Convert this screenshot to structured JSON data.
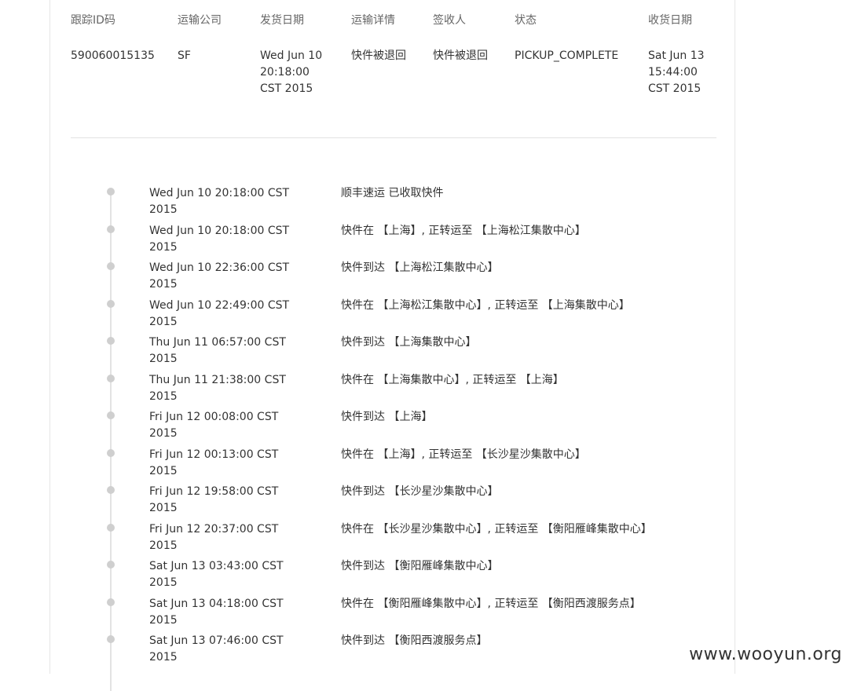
{
  "table": {
    "headers": [
      "跟踪ID码",
      "运输公司",
      "发货日期",
      "运输详情",
      "签收人",
      "状态",
      "收货日期"
    ],
    "row": [
      "590060015135",
      "SF",
      "Wed Jun 10 20:18:00 CST 2015",
      "快件被退回",
      "快件被退回",
      "PICKUP_COMPLETE",
      "Sat Jun 13 15:44:00 CST 2015"
    ]
  },
  "timeline": [
    {
      "time": "Wed Jun 10 20:18:00 CST 2015",
      "desc": "顺丰速运 已收取快件"
    },
    {
      "time": "Wed Jun 10 20:18:00 CST 2015",
      "desc": "快件在 【上海】, 正转运至 【上海松江集散中心】"
    },
    {
      "time": "Wed Jun 10 22:36:00 CST 2015",
      "desc": "快件到达 【上海松江集散中心】"
    },
    {
      "time": "Wed Jun 10 22:49:00 CST 2015",
      "desc": "快件在 【上海松江集散中心】, 正转运至 【上海集散中心】"
    },
    {
      "time": "Thu Jun 11 06:57:00 CST 2015",
      "desc": "快件到达 【上海集散中心】"
    },
    {
      "time": "Thu Jun 11 21:38:00 CST 2015",
      "desc": "快件在 【上海集散中心】, 正转运至 【上海】"
    },
    {
      "time": "Fri Jun 12 00:08:00 CST 2015",
      "desc": "快件到达 【上海】"
    },
    {
      "time": "Fri Jun 12 00:13:00 CST 2015",
      "desc": "快件在 【上海】, 正转运至 【长沙星沙集散中心】"
    },
    {
      "time": "Fri Jun 12 19:58:00 CST 2015",
      "desc": "快件到达 【长沙星沙集散中心】"
    },
    {
      "time": "Fri Jun 12 20:37:00 CST 2015",
      "desc": "快件在 【长沙星沙集散中心】, 正转运至 【衡阳雁峰集散中心】"
    },
    {
      "time": "Sat Jun 13 03:43:00 CST 2015",
      "desc": "快件到达 【衡阳雁峰集散中心】"
    },
    {
      "time": "Sat Jun 13 04:18:00 CST 2015",
      "desc": "快件在 【衡阳雁峰集散中心】, 正转运至 【衡阳西渡服务点】"
    },
    {
      "time": "Sat Jun 13 07:46:00 CST 2015",
      "desc": "快件到达 【衡阳西渡服务点】"
    }
  ],
  "watermark": "www.wooyun.org"
}
